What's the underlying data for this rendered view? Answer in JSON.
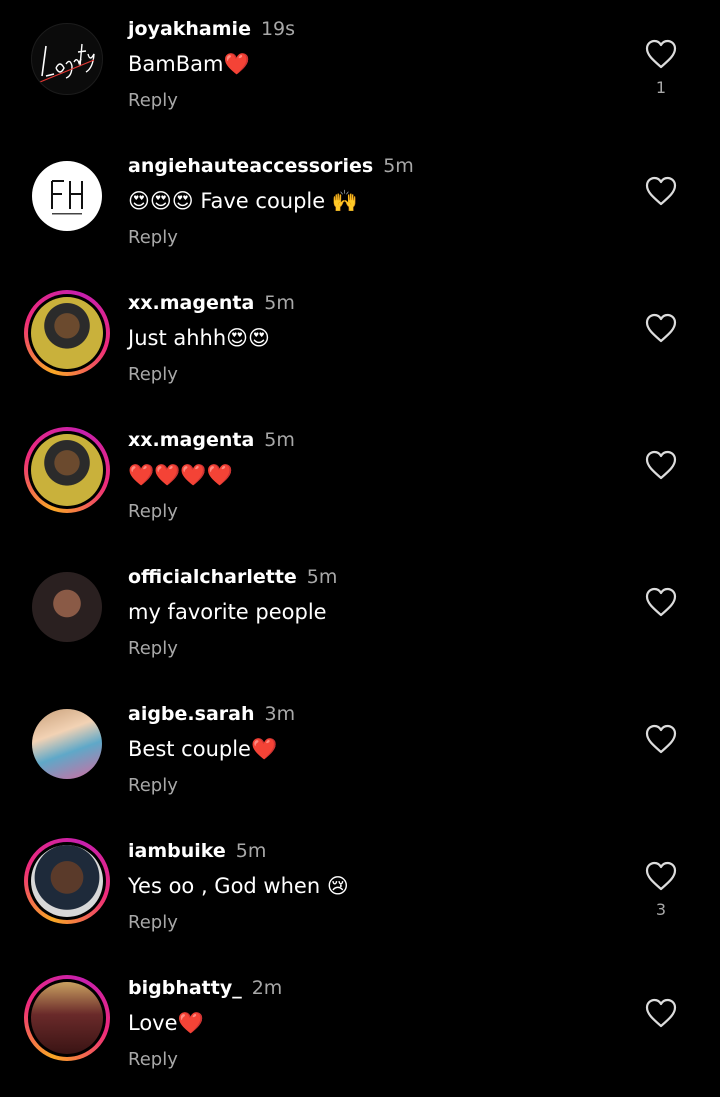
{
  "reply_label": "Reply",
  "comments": [
    {
      "username": "joyakhamie",
      "time": "19s",
      "text": "BamBam❤️",
      "likes": "1",
      "avatar": "loyalty-logo-avatar",
      "ring": false
    },
    {
      "username": "angiehauteaccessories",
      "time": "5m",
      "text": "😍😍😍 Fave couple 🙌",
      "likes": "",
      "avatar": "ah-logo-avatar",
      "ring": false
    },
    {
      "username": "xx.magenta",
      "time": "5m",
      "text": "Just ahhh😍😍",
      "likes": "",
      "avatar": "profile-photo-avatar",
      "ring": true
    },
    {
      "username": "xx.magenta",
      "time": "5m",
      "text": "❤️❤️❤️❤️",
      "likes": "",
      "avatar": "profile-photo-avatar",
      "ring": true
    },
    {
      "username": "officialcharlette",
      "time": "5m",
      "text": "my favorite people",
      "likes": "",
      "avatar": "profile-photo-avatar",
      "ring": false
    },
    {
      "username": "aigbe.sarah",
      "time": "3m",
      "text": "Best couple❤️",
      "likes": "",
      "avatar": "profile-photo-avatar",
      "ring": false
    },
    {
      "username": "iambuike",
      "time": "5m",
      "text": "Yes oo , God when 😢",
      "likes": "3",
      "avatar": "profile-photo-avatar",
      "ring": true
    },
    {
      "username": "bigbhatty_",
      "time": "2m",
      "text": "Love❤️",
      "likes": "",
      "avatar": "profile-photo-avatar",
      "ring": true
    }
  ],
  "colors": {
    "background": "#000000",
    "secondary_text": "#a8a8a8",
    "ring_start": "#f9a825",
    "ring_end": "#c61fae"
  }
}
